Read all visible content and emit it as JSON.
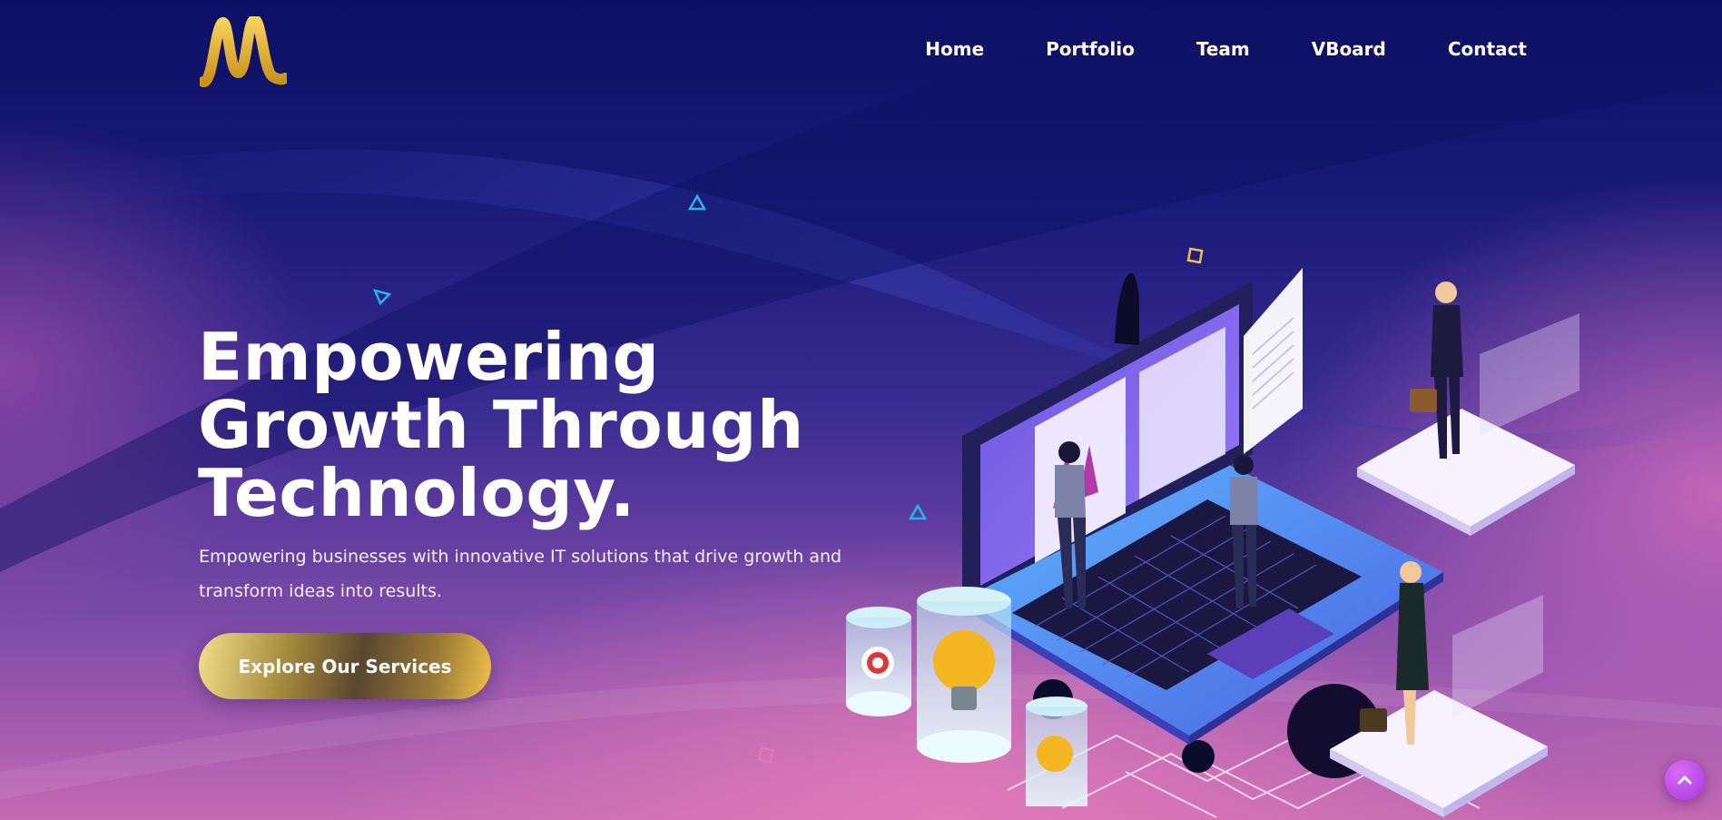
{
  "brand": {
    "logo_icon": "m-wave-logo-icon",
    "logo_color": "#f0c24a"
  },
  "nav": {
    "items": [
      {
        "label": "Home"
      },
      {
        "label": "Portfolio"
      },
      {
        "label": "Team"
      },
      {
        "label": "VBoard"
      },
      {
        "label": "Contact"
      }
    ]
  },
  "hero": {
    "title_lines": [
      "Empowering",
      "Growth Through",
      "Technology."
    ],
    "subtitle": "Empowering businesses with innovative IT solutions that drive growth and transform ideas into results.",
    "cta_label": "Explore Our Services",
    "illustration_icon": "isometric-laptop-team-illustration",
    "accent_colors": {
      "gold": "#f0c24a",
      "cyan": "#23b6ea",
      "purple": "#a838e0",
      "pink": "#e07ab8"
    }
  },
  "scroll_top": {
    "icon": "chevron-up-icon"
  }
}
